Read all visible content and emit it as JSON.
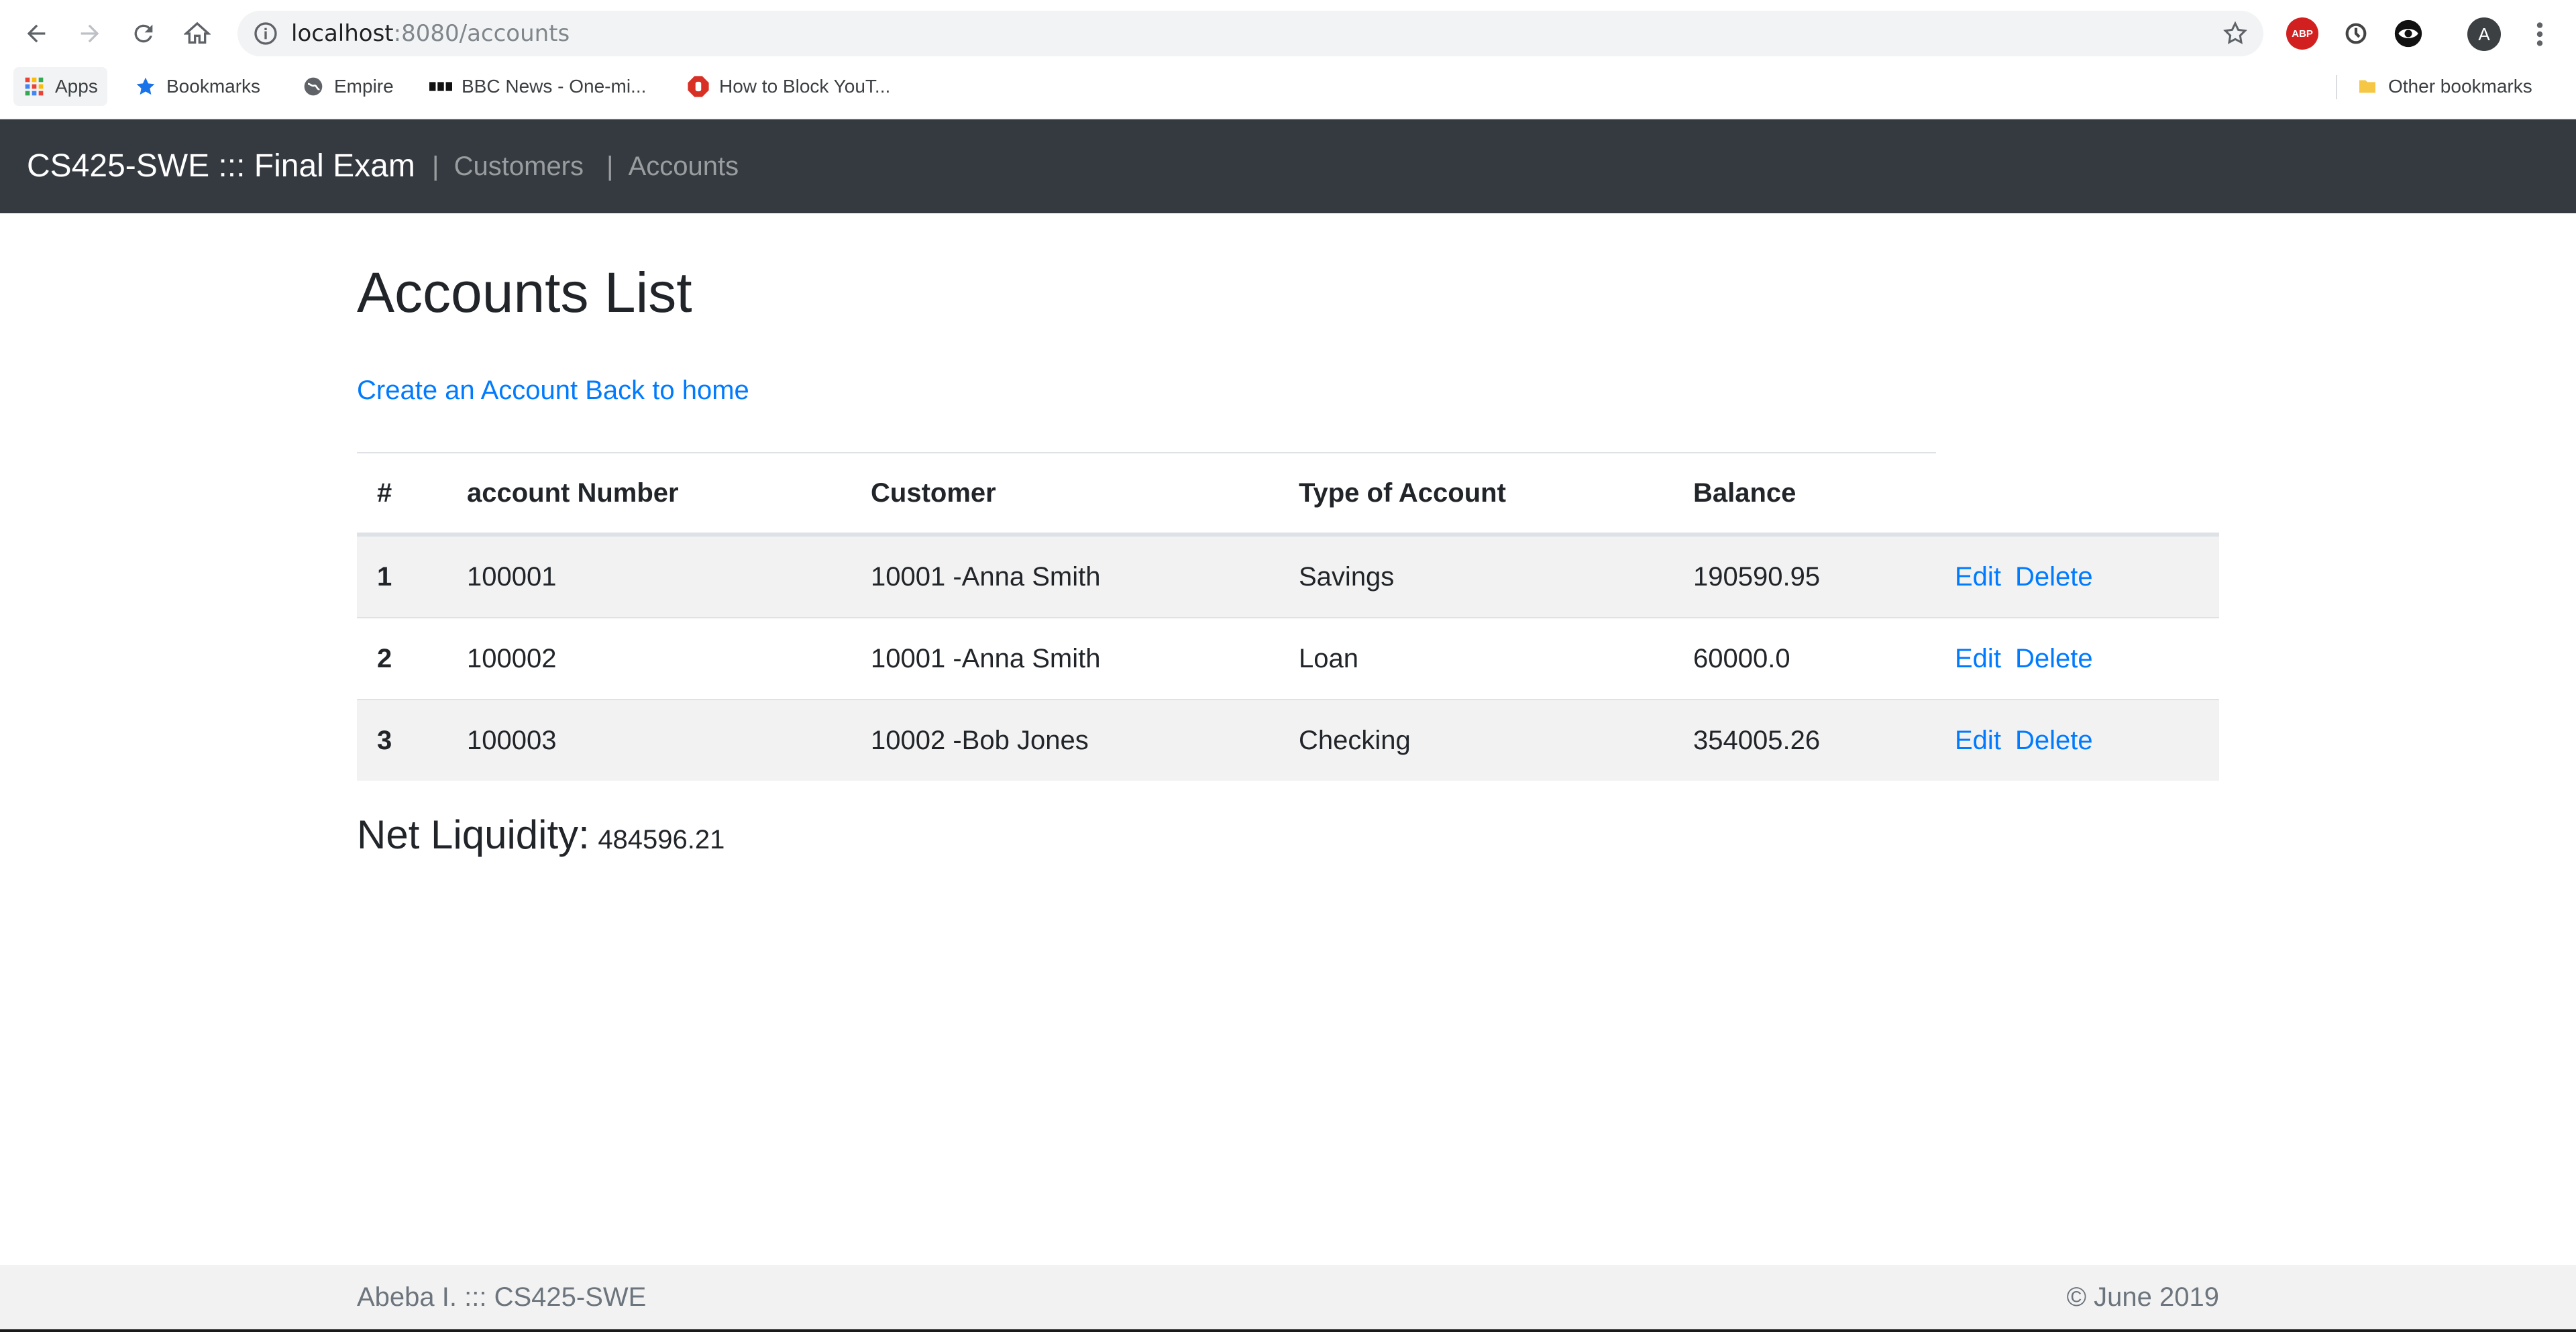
{
  "browser": {
    "url_host": "localhost",
    "url_path": ":8080/accounts",
    "bookmarks": [
      {
        "label": "Apps",
        "icon": "apps-grid-icon"
      },
      {
        "label": "Bookmarks",
        "icon": "star-icon"
      },
      {
        "label": "Empire",
        "icon": "globe-icon"
      },
      {
        "label": "BBC News - One-mi...",
        "icon": "bbc-icon"
      },
      {
        "label": "How to Block YouT...",
        "icon": "stop-hand-icon"
      }
    ],
    "other_bookmarks": "Other bookmarks",
    "extension_abp": "ABP",
    "avatar_letter": "A"
  },
  "navbar": {
    "brand": "CS425-SWE ::: Final Exam",
    "links": [
      "Customers",
      "Accounts"
    ]
  },
  "page": {
    "title": "Accounts List",
    "create_link": "Create an Account",
    "home_link": "Back to home"
  },
  "table": {
    "headers": [
      "#",
      "account Number",
      "Customer",
      "Type of Account",
      "Balance"
    ],
    "rows": [
      {
        "num": "1",
        "account": "100001",
        "customer": "10001 -Anna Smith",
        "type": "Savings",
        "balance": "190590.95"
      },
      {
        "num": "2",
        "account": "100002",
        "customer": "10001 -Anna Smith",
        "type": "Loan",
        "balance": "60000.0"
      },
      {
        "num": "3",
        "account": "100003",
        "customer": "10002 -Bob Jones",
        "type": "Checking",
        "balance": "354005.26"
      }
    ],
    "edit_label": "Edit",
    "delete_label": "Delete"
  },
  "summary": {
    "label": "Net Liquidity:",
    "value": "484596.21"
  },
  "footer": {
    "left": "Abeba I. ::: CS425-SWE",
    "right": "© June 2019"
  },
  "colors": {
    "navbar_bg": "#343a40",
    "link": "#007bff",
    "stripe": "#f2f2f2"
  }
}
